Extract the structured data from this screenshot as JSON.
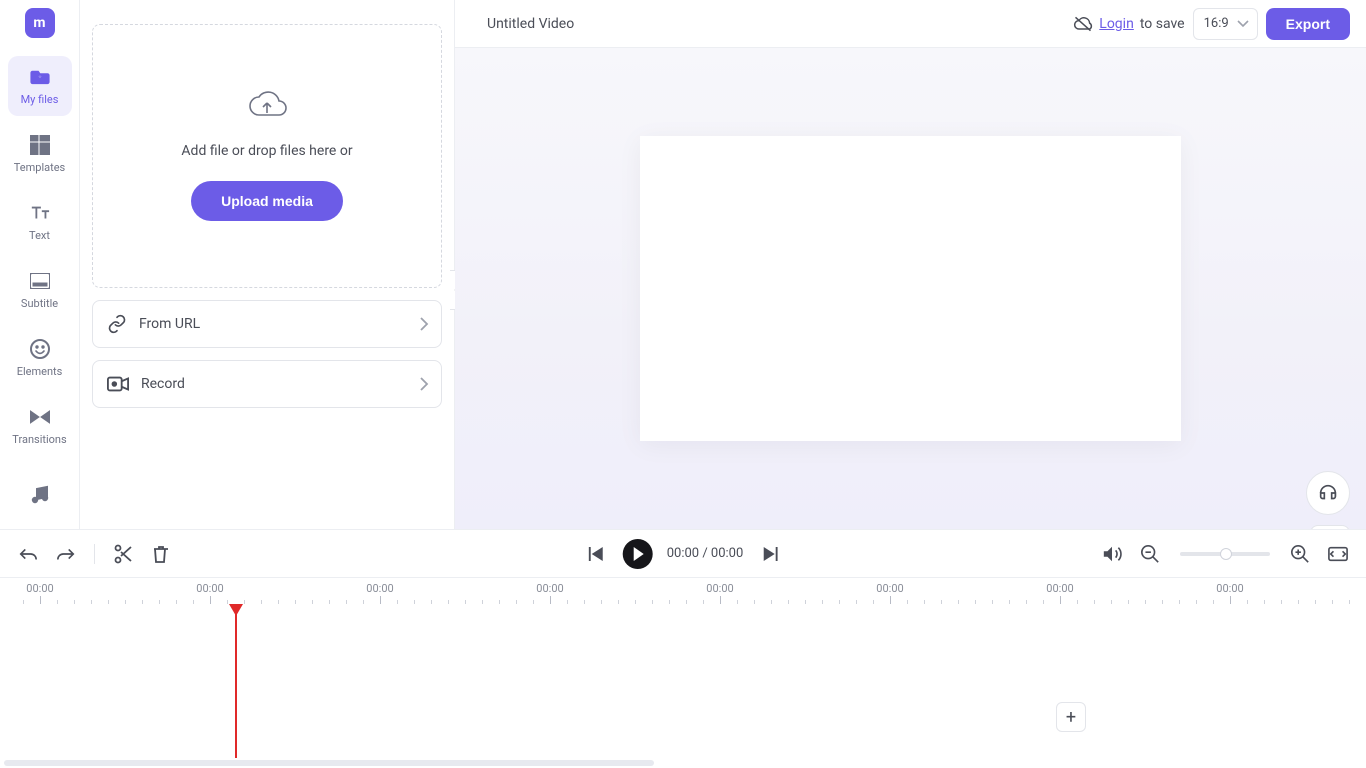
{
  "app": {
    "logo_initial": "m"
  },
  "leftnav": {
    "items": [
      {
        "label": "My files"
      },
      {
        "label": "Templates"
      },
      {
        "label": "Text"
      },
      {
        "label": "Subtitle"
      },
      {
        "label": "Elements"
      },
      {
        "label": "Transitions"
      }
    ]
  },
  "panel": {
    "drop_hint": "Add file or drop files here or",
    "upload_label": "Upload media",
    "from_url_label": "From URL",
    "record_label": "Record"
  },
  "header": {
    "title": "Untitled Video",
    "login_label": "Login",
    "to_save_label": "to save",
    "ratio_label": "16:9",
    "export_label": "Export"
  },
  "playback": {
    "current": "00:00",
    "sep": "/",
    "total": "00:00"
  },
  "timeline": {
    "labels": [
      "00:00",
      "00:00",
      "00:00",
      "00:00",
      "00:00",
      "00:00",
      "00:00",
      "00:00"
    ],
    "add_label": "+"
  }
}
